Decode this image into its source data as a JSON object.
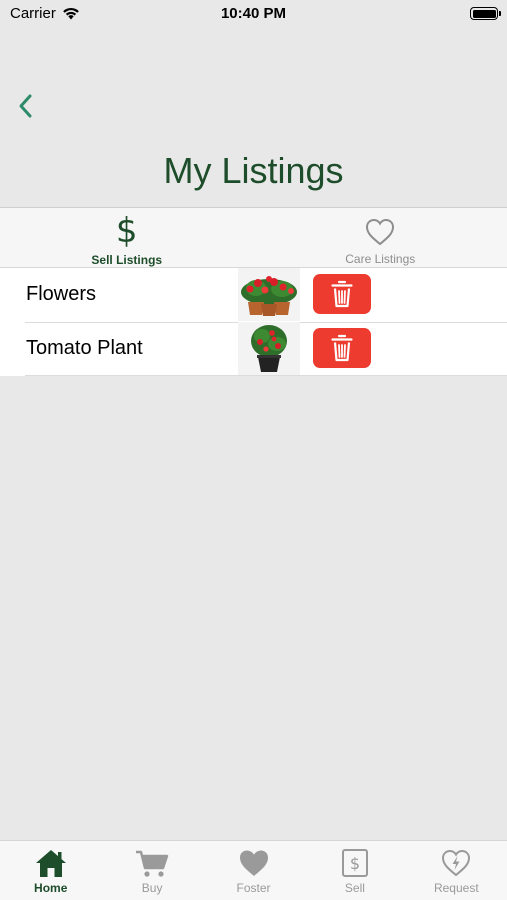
{
  "status_bar": {
    "carrier": "Carrier",
    "time": "10:40 PM"
  },
  "header": {
    "title": "My Listings",
    "back_icon": "chevron-left-icon"
  },
  "segments": [
    {
      "label": "Sell Listings",
      "icon": "dollar-sign-icon",
      "active": true
    },
    {
      "label": "Care Listings",
      "icon": "heart-outline-icon",
      "active": false
    }
  ],
  "listings": [
    {
      "name": "Flowers",
      "thumbnail": "red flowers in pots"
    },
    {
      "name": "Tomato Plant",
      "thumbnail": "tomato plant in black pot"
    }
  ],
  "tab_bar": [
    {
      "label": "Home",
      "icon": "home-icon",
      "active": true
    },
    {
      "label": "Buy",
      "icon": "cart-icon",
      "active": false
    },
    {
      "label": "Foster",
      "icon": "heart-icon",
      "active": false
    },
    {
      "label": "Sell",
      "icon": "dollar-box-icon",
      "active": false
    },
    {
      "label": "Request",
      "icon": "heart-bolt-icon",
      "active": false
    }
  ],
  "colors": {
    "accent_green": "#1d4d2a",
    "back_green": "#2e8b6a",
    "delete_red": "#ee3b2f",
    "background": "#e8e8e8"
  }
}
